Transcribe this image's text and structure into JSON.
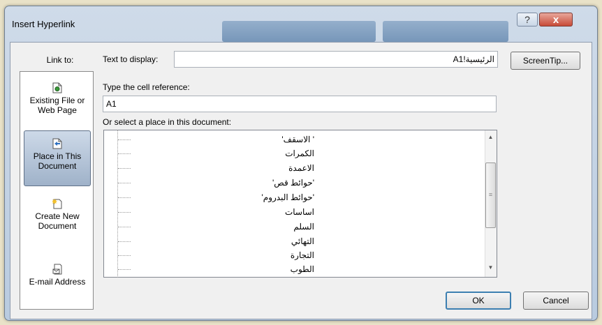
{
  "window": {
    "title": "Insert Hyperlink",
    "help_glyph": "?",
    "close_glyph": "x"
  },
  "link_to": {
    "label": "Link to:",
    "items": [
      {
        "label_1": "Existing File or",
        "label_2": "Web Page",
        "icon": "existing-file-icon"
      },
      {
        "label_1": "Place in This",
        "label_2": "Document",
        "icon": "place-in-document-icon",
        "selected": true
      },
      {
        "label_1": "Create New",
        "label_2": "Document",
        "icon": "create-new-document-icon"
      },
      {
        "label_1": "E-mail Address",
        "label_2": "",
        "icon": "email-address-icon"
      }
    ]
  },
  "text_to_display": {
    "label": "Text to display:",
    "value": "الرئيسية!A1"
  },
  "screentip_label": "ScreenTip...",
  "cell_reference": {
    "label": "Type the cell reference:",
    "value": "A1"
  },
  "place_list": {
    "label": "Or select a place in this document:",
    "items": [
      "' الاسقف'",
      "الكمرات",
      "الاعمدة",
      "'حوائط قص'",
      "'حوائط البدروم'",
      "اساسات",
      "السلم",
      "التهائي",
      "التجارة",
      "الطوب"
    ]
  },
  "buttons": {
    "ok": "OK",
    "cancel": "Cancel"
  },
  "colors": {
    "title_bar": "#cfdbe9",
    "close_button": "#c84b38",
    "selected_item": "#9fb2c9",
    "ok_border": "#3c7fb1"
  }
}
